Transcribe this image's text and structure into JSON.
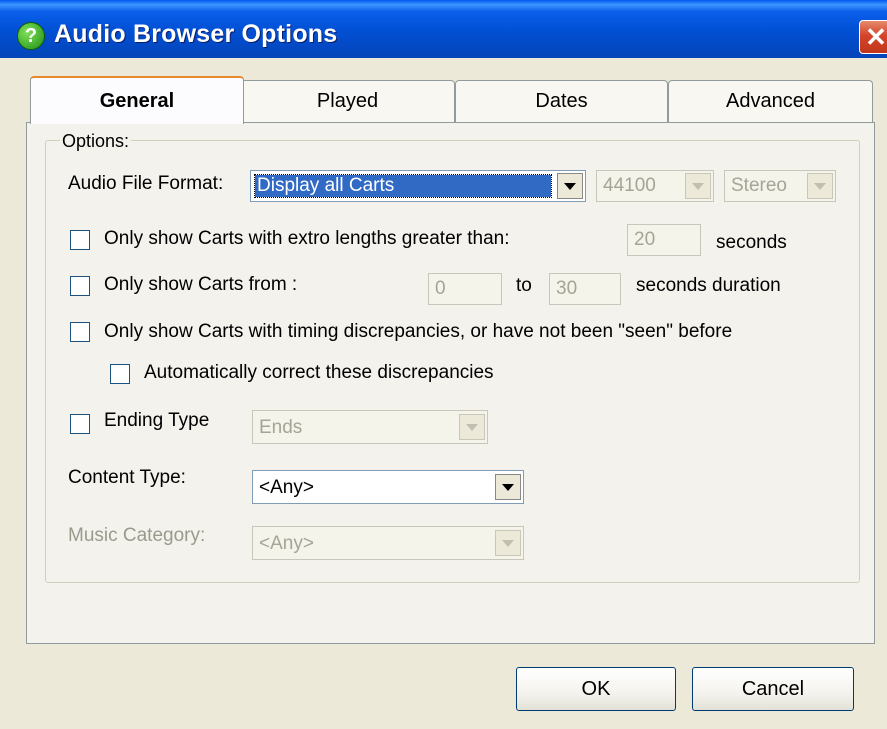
{
  "window": {
    "title": "Audio Browser Options",
    "help_glyph": "?",
    "close_glyph": "✕"
  },
  "tabs": [
    "General",
    "Played",
    "Dates",
    "Advanced"
  ],
  "group": {
    "label": "Options:"
  },
  "audio_format": {
    "label": "Audio File Format:",
    "format_value": "Display all Carts",
    "rate_value": "44100",
    "channels_value": "Stereo"
  },
  "extro": {
    "label": "Only show Carts with extro lengths greater than:",
    "value": "20",
    "unit": "seconds"
  },
  "duration": {
    "label": "Only show Carts from :",
    "from_value": "0",
    "to_label": "to",
    "to_value": "30",
    "unit": "seconds duration"
  },
  "timing": {
    "label": "Only show Carts with timing discrepancies, or have not been \"seen\" before",
    "auto_label": "Automatically correct these discrepancies"
  },
  "ending": {
    "label": "Ending Type",
    "value": "Ends"
  },
  "content": {
    "label": "Content Type:",
    "value": "<Any>"
  },
  "music": {
    "label": "Music Category:",
    "value": "<Any>"
  },
  "buttons": {
    "ok": "OK",
    "cancel": "Cancel"
  }
}
